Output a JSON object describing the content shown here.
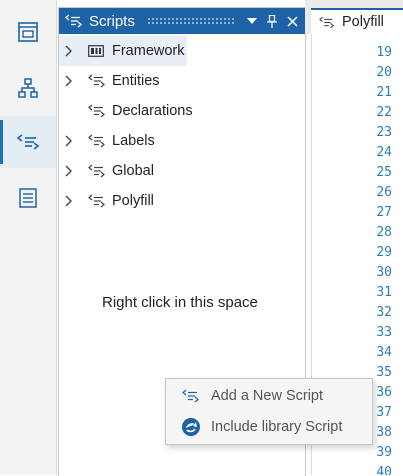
{
  "rail": {
    "items": [
      {
        "icon": "window-icon",
        "active": false
      },
      {
        "icon": "hierarchy-icon",
        "active": false
      },
      {
        "icon": "script-icon",
        "active": true
      },
      {
        "icon": "list-icon",
        "active": false
      }
    ]
  },
  "scripts_panel": {
    "title": "Scripts",
    "header_buttons": [
      "dropdown-icon",
      "pin-icon",
      "close-icon"
    ],
    "items": [
      {
        "label": "Framework",
        "expandable": true,
        "icon": "library-icon",
        "selected": true
      },
      {
        "label": "Entities",
        "expandable": true,
        "icon": "script-icon",
        "selected": false
      },
      {
        "label": "Declarations",
        "expandable": false,
        "icon": "script-icon",
        "selected": false
      },
      {
        "label": "Labels",
        "expandable": true,
        "icon": "script-icon",
        "selected": false
      },
      {
        "label": "Global",
        "expandable": true,
        "icon": "script-icon",
        "selected": false
      },
      {
        "label": "Polyfill",
        "expandable": true,
        "icon": "script-icon",
        "selected": false
      }
    ],
    "hint": "Right click in this space"
  },
  "editor": {
    "tab_label": "Polyfill",
    "line_numbers": [
      "19",
      "20",
      "21",
      "22",
      "23",
      "24",
      "25",
      "26",
      "27",
      "28",
      "29",
      "30",
      "31",
      "32",
      "33",
      "34",
      "35",
      "36",
      "37",
      "38",
      "39",
      "40"
    ]
  },
  "context_menu": {
    "items": [
      {
        "label": "Add a New Script",
        "icon": "add-script-icon"
      },
      {
        "label": "Include library Script",
        "icon": "include-library-icon"
      }
    ]
  },
  "colors": {
    "header_blue": "#1e63a7",
    "line_number": "#2a7fb5",
    "selection": "#e8eef6"
  }
}
